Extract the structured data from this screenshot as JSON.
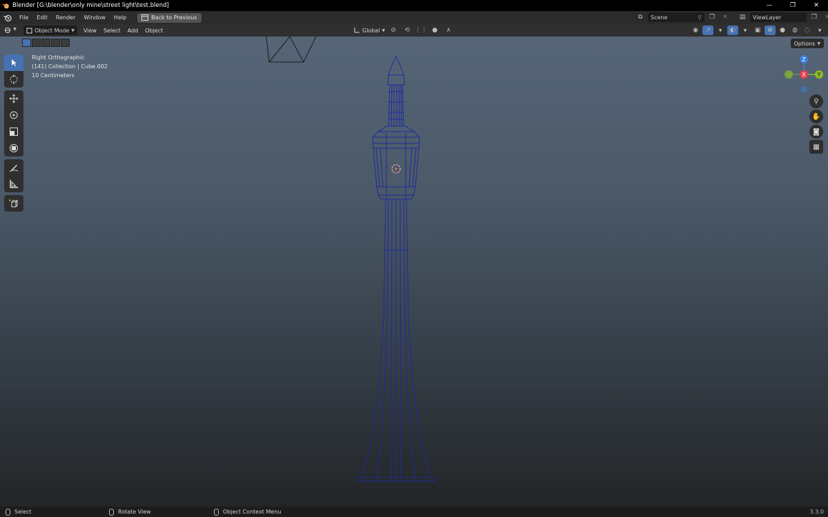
{
  "window": {
    "title": "Blender [G:\\blender\\only mine\\street light\\test.blend]",
    "controls": [
      "—",
      "❐",
      "✕"
    ]
  },
  "topbar": {
    "menus": [
      "File",
      "Edit",
      "Render",
      "Window",
      "Help"
    ],
    "back_button": "Back to Previous",
    "scene": "Scene",
    "view_layer": "ViewLayer"
  },
  "viewport_header": {
    "mode": "Object Mode",
    "menus": [
      "View",
      "Select",
      "Add",
      "Object"
    ],
    "transform_orientation": "Global"
  },
  "viewport": {
    "view_name": "Right Orthographic",
    "collection_info": "(141) Collection | Cube.002",
    "scale_info": "10 Centimeters",
    "options_label": "Options",
    "gizmo_axes": {
      "z": "Z",
      "x": "X",
      "y": "Y"
    }
  },
  "statusbar": {
    "items": [
      "Select",
      "Rotate View",
      "Object Context Menu"
    ],
    "version": "3.3.0"
  },
  "colors": {
    "accent": "#4772b3",
    "axis_x": "#e4414f",
    "axis_y": "#8bbd28",
    "axis_z": "#3a7fe0",
    "wire": "#1d2a9c"
  }
}
